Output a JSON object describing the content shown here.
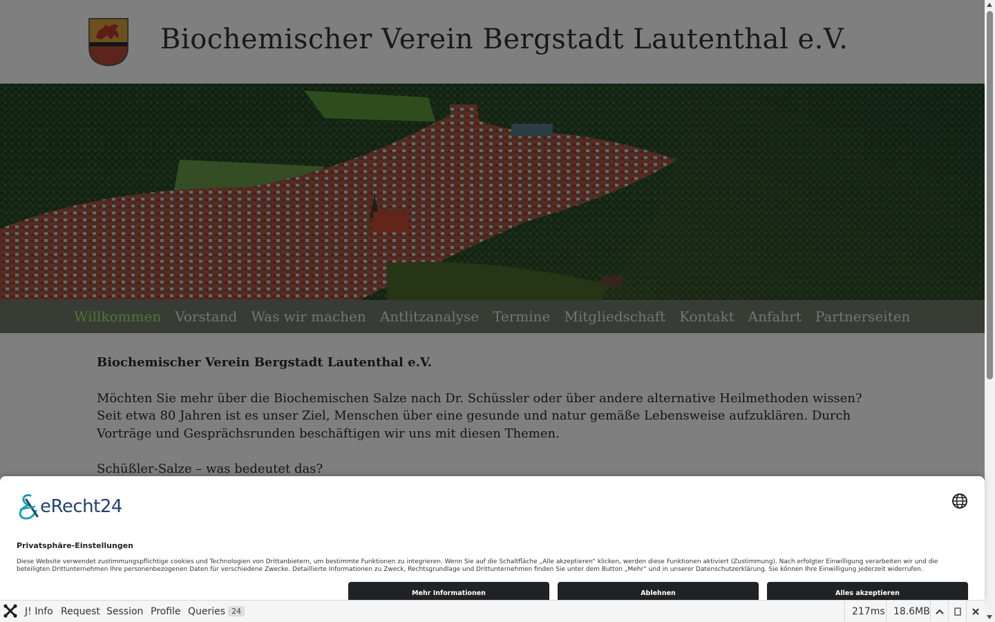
{
  "site": {
    "title": "Biochemischer Verein Bergstadt Lautenthal e.V.",
    "nav": [
      {
        "label": "Willkommen",
        "active": true
      },
      {
        "label": "Vorstand"
      },
      {
        "label": "Was wir machen"
      },
      {
        "label": "Antlitzanalyse"
      },
      {
        "label": "Termine"
      },
      {
        "label": "Mitgliedschaft"
      },
      {
        "label": "Kontakt"
      },
      {
        "label": "Anfahrt"
      },
      {
        "label": "Partnerseiten"
      }
    ],
    "content": {
      "heading": "Biochemischer Verein Bergstadt Lautenthal e.V.",
      "para1_line1": "Möchten Sie mehr über die Biochemischen Salze nach Dr. Schüssler oder über andere alternative Heilmethoden wissen?",
      "para1_rest": "Seit  etwa  80  Jahren  ist  es  unser  Ziel, Menschen über eine  gesunde und natur gemäße Lebensweise aufzuklären. Durch Vorträge und Gesprächsrunden beschäftigen wir uns mit diesen Themen.",
      "para2": "Schüßler-Salze – was bedeutet das?"
    },
    "colors": {
      "nav_bg": "#6f7a6a",
      "nav_active": "#a6e36a"
    }
  },
  "consent": {
    "logo_text": "eRecht24",
    "title": "Privatsphäre-Einstellungen",
    "text": "Diese Website verwendet zustimmungspflichtige cookies und Technologien von Drittanbietern, um bestimmte Funktionen zu integrieren. Wenn Sie auf die Schaltfläche „Alle akzeptieren“ klicken, werden diese Funktionen aktiviert (Zustimmung). Nach erfolgter Einwilligung verarbeiten wir und die beteiligten Drittunternehmen Ihre personenbezogenen Daten für verschiedene Zwecke. Detaillierte Informationen zu Zweck, Rechtsgrundlage und Drittunternehmen finden Sie unter dem Button „Mehr“ und in unserer Datenschutzerklärung. Sie können Ihre Einwilligung jederzeit widerrufen.",
    "buttons": {
      "more": "Mehr Informationen",
      "decline": "Ablehnen",
      "accept": "Alles akzeptieren"
    },
    "colors": {
      "button_bg": "#1f2326",
      "logo": "#23426a"
    }
  },
  "debugbar": {
    "items": [
      "J! Info",
      "Request",
      "Session",
      "Profile",
      "Queries"
    ],
    "queries_count": "24",
    "time": "217ms",
    "memory": "18.6MB"
  }
}
